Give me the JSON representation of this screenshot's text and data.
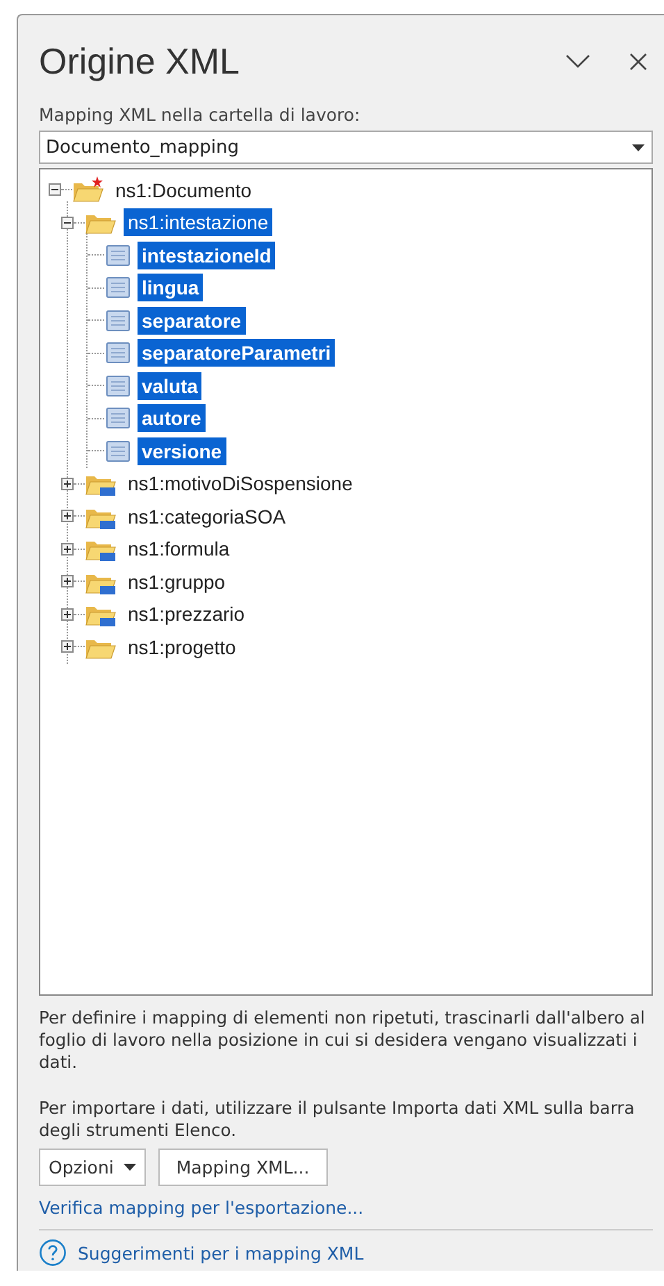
{
  "pane": {
    "title": "Origine XML",
    "mapping_label": "Mapping XML nella cartella di lavoro:",
    "mapping_value": "Documento_mapping"
  },
  "tree": [
    {
      "label": "ns1:Documento",
      "kind": "root",
      "expanded": true,
      "selected": false,
      "children": [
        {
          "label": "ns1:intestazione",
          "kind": "folder",
          "expanded": true,
          "selected": true,
          "children": [
            {
              "label": "intestazioneId",
              "kind": "element",
              "selected": true
            },
            {
              "label": "lingua",
              "kind": "element",
              "selected": true
            },
            {
              "label": "separatore",
              "kind": "element",
              "selected": true
            },
            {
              "label": "separatoreParametri",
              "kind": "element",
              "selected": true
            },
            {
              "label": "valuta",
              "kind": "element",
              "selected": true
            },
            {
              "label": "autore",
              "kind": "element",
              "selected": true
            },
            {
              "label": "versione",
              "kind": "element",
              "selected": true
            }
          ]
        },
        {
          "label": "ns1:motivoDiSospensione",
          "kind": "repeating",
          "expanded": false,
          "selected": false
        },
        {
          "label": "ns1:categoriaSOA",
          "kind": "repeating",
          "expanded": false,
          "selected": false
        },
        {
          "label": "ns1:formula",
          "kind": "repeating",
          "expanded": false,
          "selected": false
        },
        {
          "label": "ns1:gruppo",
          "kind": "repeating",
          "expanded": false,
          "selected": false
        },
        {
          "label": "ns1:prezzario",
          "kind": "repeating",
          "expanded": false,
          "selected": false
        },
        {
          "label": "ns1:progetto",
          "kind": "folder",
          "expanded": false,
          "selected": false
        }
      ]
    }
  ],
  "hint_1": "Per definire i mapping di elementi non ripetuti, trascinarli dall'albero al foglio di lavoro nella posizione in cui si desidera vengano visualizzati i dati.",
  "hint_2": "Per importare i dati, utilizzare il pulsante Importa dati XML sulla barra degli strumenti Elenco.",
  "buttons": [
    {
      "label": "Opzioni",
      "kind": "dropdown"
    },
    {
      "label": "Mapping XML...",
      "kind": "plain"
    }
  ],
  "verify_link": "Verifica mapping per l'esportazione...",
  "help_link": "Suggerimenti per i mapping XML"
}
